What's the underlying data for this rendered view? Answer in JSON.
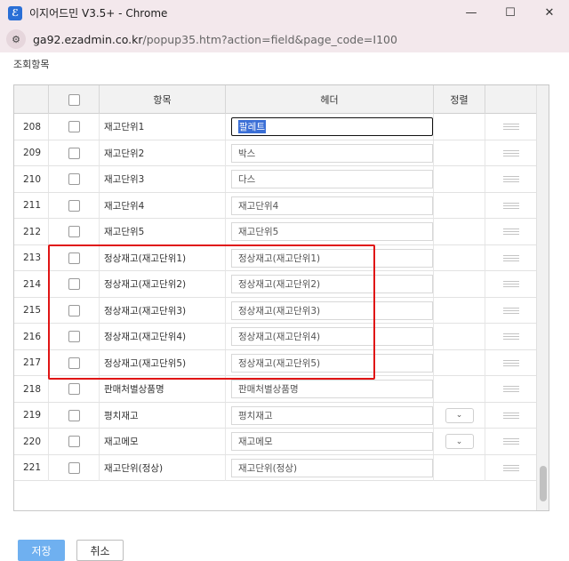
{
  "window": {
    "title": "이지어드민 V3.5+ - Chrome",
    "minimize": "—",
    "maximize": "☐",
    "close": "✕"
  },
  "address": {
    "host": "ga92.ezadmin.co.kr",
    "path": "/popup35.htm?action=field&page_code=I100"
  },
  "section_title": "조회항목",
  "columns": {
    "item": "항목",
    "header": "헤더",
    "sort": "정렬"
  },
  "rows": [
    {
      "num": "208",
      "item": "재고단위1",
      "header": "팔레트",
      "active": true,
      "sort": false
    },
    {
      "num": "209",
      "item": "재고단위2",
      "header": "박스",
      "sort": false
    },
    {
      "num": "210",
      "item": "재고단위3",
      "header": "다스",
      "sort": false
    },
    {
      "num": "211",
      "item": "재고단위4",
      "header": "재고단위4",
      "sort": false
    },
    {
      "num": "212",
      "item": "재고단위5",
      "header": "재고단위5",
      "sort": false
    },
    {
      "num": "213",
      "item": "정상재고(재고단위1)",
      "header": "정상재고(재고단위1)",
      "sort": false
    },
    {
      "num": "214",
      "item": "정상재고(재고단위2)",
      "header": "정상재고(재고단위2)",
      "sort": false
    },
    {
      "num": "215",
      "item": "정상재고(재고단위3)",
      "header": "정상재고(재고단위3)",
      "sort": false
    },
    {
      "num": "216",
      "item": "정상재고(재고단위4)",
      "header": "정상재고(재고단위4)",
      "sort": false
    },
    {
      "num": "217",
      "item": "정상재고(재고단위5)",
      "header": "정상재고(재고단위5)",
      "sort": false
    },
    {
      "num": "218",
      "item": "판매처별상품명",
      "header": "판매처별상품명",
      "sort": false
    },
    {
      "num": "219",
      "item": "평치재고",
      "header": "평치재고",
      "sort": true
    },
    {
      "num": "220",
      "item": "재고메모",
      "header": "재고메모",
      "sort": true
    },
    {
      "num": "221",
      "item": "재고단위(정상)",
      "header": "재고단위(정상)",
      "sort": false
    }
  ],
  "buttons": {
    "save": "저장",
    "cancel": "취소"
  },
  "colors": {
    "save_button": "#6fb0f0",
    "highlight": "#e01515",
    "selection": "#3b6fd6"
  }
}
